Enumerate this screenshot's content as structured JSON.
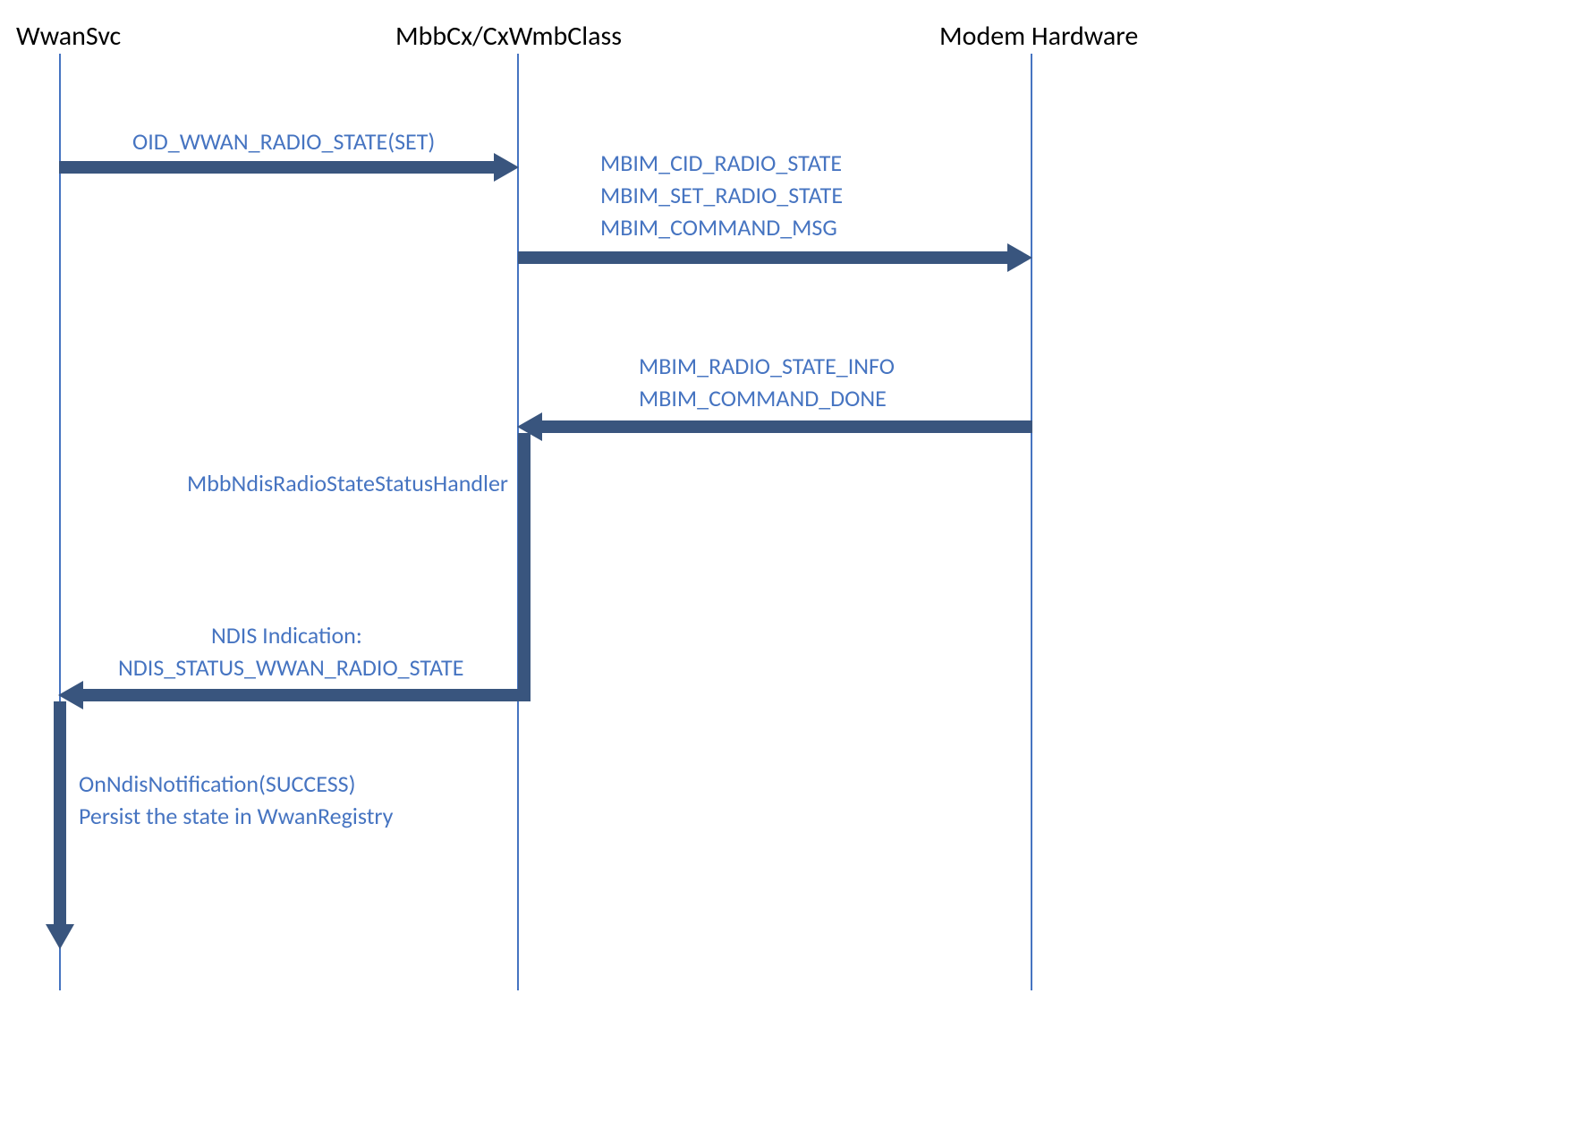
{
  "participants": {
    "wwansvc": "WwanSvc",
    "mbbcx": "MbbCx/CxWmbClass",
    "modem": "Modem Hardware"
  },
  "messages": {
    "oid_set": "OID_WWAN_RADIO_STATE(SET)",
    "mbim_cid": "MBIM_CID_RADIO_STATE",
    "mbim_set": "MBIM_SET_RADIO_STATE",
    "mbim_cmd": "MBIM_COMMAND_MSG",
    "mbim_info": "MBIM_RADIO_STATE_INFO",
    "mbim_done": "MBIM_COMMAND_DONE",
    "handler": "MbbNdisRadioStateStatusHandler",
    "ndis_ind_line1": "NDIS Indication:",
    "ndis_ind_line2": "NDIS_STATUS_WWAN_RADIO_STATE",
    "onndis_line1": "OnNdisNotification(SUCCESS)",
    "onndis_line2": "Persist the state in WwanRegistry"
  },
  "colors": {
    "text_blue": "#4674c1",
    "arrow_dark": "#39557e",
    "lifeline": "#4674c1"
  }
}
